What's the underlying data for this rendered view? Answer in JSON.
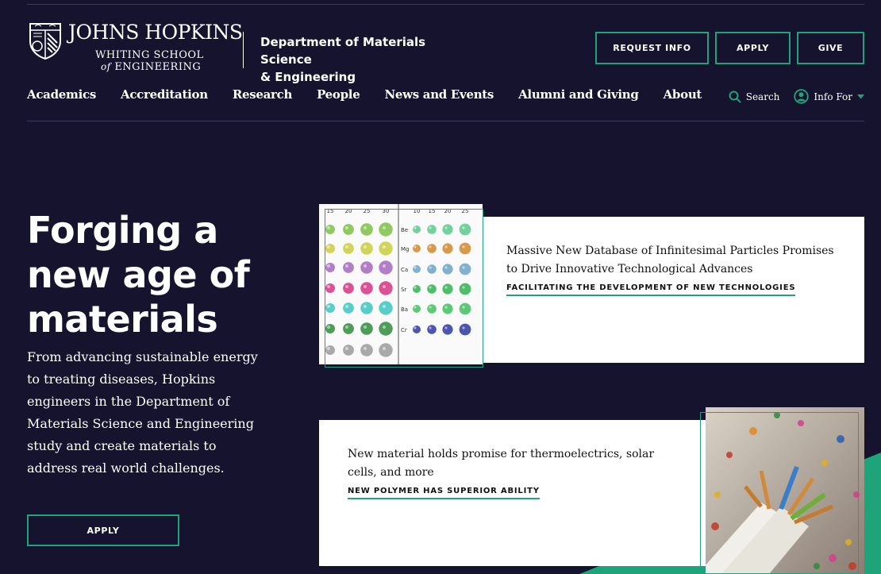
{
  "header": {
    "logo": {
      "line1": "JOHNS HOPKINS",
      "line2": "WHITING SCHOOL",
      "line3_prefix": "of",
      "line3": "ENGINEERING"
    },
    "department_line1": "Department of Materials Science",
    "department_line2": "& Engineering",
    "buttons": {
      "request_info": "REQUEST INFO",
      "apply": "APPLY",
      "give": "GIVE"
    }
  },
  "nav": {
    "items": [
      "Academics",
      "Accreditation",
      "Research",
      "People",
      "News and Events",
      "Alumni and Giving",
      "About"
    ],
    "search_label": "Search",
    "info_for_label": "Info For"
  },
  "hero": {
    "title": "Forging a new age of materials",
    "description": "From advancing sustainable energy to treating diseases, Hopkins engineers in the Department of Materials Science and Engineering study and create materials to address real world challenges.",
    "apply_label": "APPLY"
  },
  "news": [
    {
      "title": "Massive New Database of Infinitesimal Particles Promises to Drive Innovative Technological Advances",
      "link": "FACILITATING THE DEVELOPMENT OF NEW TECHNOLOGIES",
      "image_row_labels": [
        "Be",
        "Mg",
        "Ca",
        "Sr",
        "Ba",
        "Cr"
      ],
      "image_col_labels_left": [
        "15",
        "20",
        "25",
        "30"
      ],
      "image_col_labels_right": [
        "10",
        "15",
        "20",
        "25"
      ]
    },
    {
      "title": "New material holds promise for thermoelectrics, solar cells, and more",
      "link": "NEW POLYMER HAS SUPERIOR ABILITY"
    }
  ],
  "colors": {
    "background": "#15132e",
    "accent": "#1fa37b",
    "card": "#ffffff"
  },
  "icons": [
    "search-icon",
    "user-circle-icon",
    "caret-down-icon",
    "shield-icon"
  ]
}
